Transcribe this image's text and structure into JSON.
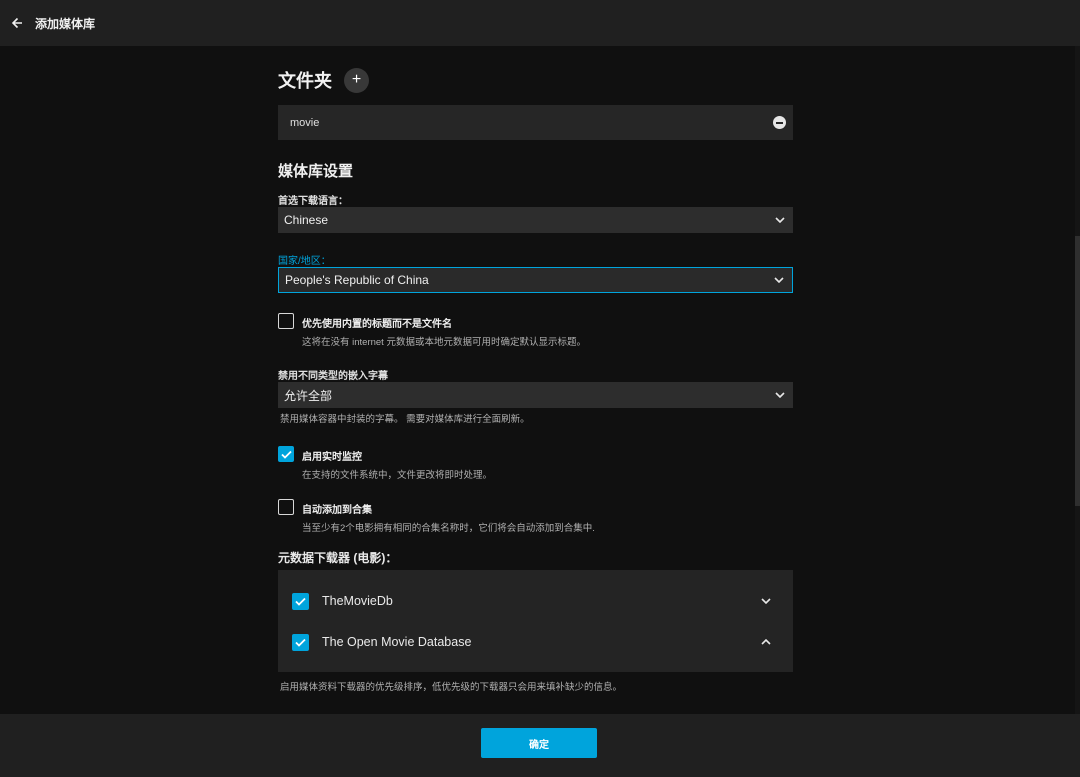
{
  "header": {
    "title": "添加媒体库"
  },
  "folders": {
    "heading": "文件夹",
    "add_label": "+",
    "items": [
      {
        "path": "movie"
      }
    ]
  },
  "settings": {
    "heading": "媒体库设置",
    "language": {
      "label": "首选下载语言：",
      "value": "Chinese"
    },
    "country": {
      "label": "国家/地区：",
      "value": "People's Republic of China"
    },
    "prefer_embedded_titles": {
      "label": "优先使用内置的标题而不是文件名",
      "help": "这将在没有 internet 元数据或本地元数据可用时确定默认显示标题。",
      "checked": false
    },
    "embedded_subtitles": {
      "label": "禁用不同类型的嵌入字幕",
      "value": "允许全部",
      "help": "禁用媒体容器中封装的字幕。 需要对媒体库进行全面刷新。"
    },
    "realtime_monitor": {
      "label": "启用实时监控",
      "help": "在支持的文件系统中，文件更改将即时处理。",
      "checked": true
    },
    "auto_collections": {
      "label": "自动添加到合集",
      "help": "当至少有2个电影拥有相同的合集名称时，它们将会自动添加到合集中.",
      "checked": false
    },
    "metadata_fetchers": {
      "heading": "元数据下载器 (电影)：",
      "items": [
        {
          "name": "TheMovieDb",
          "checked": true,
          "arrow": "down"
        },
        {
          "name": "The Open Movie Database",
          "checked": true,
          "arrow": "up"
        }
      ],
      "help": "启用媒体资料下载器的优先级排序，低优先级的下载器只会用来填补缺少的信息。"
    }
  },
  "footer": {
    "ok_label": "确定"
  },
  "colors": {
    "accent": "#00a4dc",
    "background": "#101010",
    "header": "#202020"
  }
}
